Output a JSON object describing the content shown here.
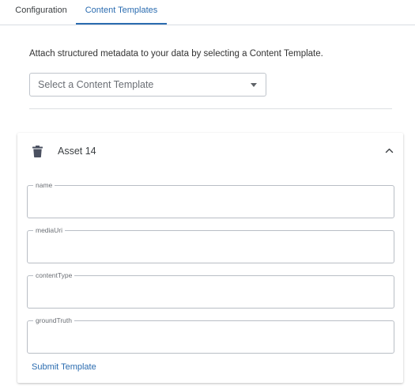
{
  "tabs": [
    {
      "label": "Configuration",
      "active": false
    },
    {
      "label": "Content Templates",
      "active": true
    }
  ],
  "intro_text": "Attach structured metadata to your data by selecting a Content Template.",
  "template_select": {
    "placeholder": "Select a Content Template"
  },
  "asset_card": {
    "title": "Asset 14",
    "expanded": true,
    "fields": [
      {
        "label": "name",
        "value": ""
      },
      {
        "label": "mediaUri",
        "value": ""
      },
      {
        "label": "contentType",
        "value": ""
      },
      {
        "label": "groundTruth",
        "value": ""
      }
    ],
    "submit_label": "Submit Template"
  },
  "colors": {
    "accent": "#2b6cb0",
    "border": "#b9bec5",
    "icon": "#4a5060"
  },
  "icons": {
    "delete": "trash-icon",
    "collapse": "chevron-up-icon",
    "dropdown": "caret-down-icon"
  }
}
